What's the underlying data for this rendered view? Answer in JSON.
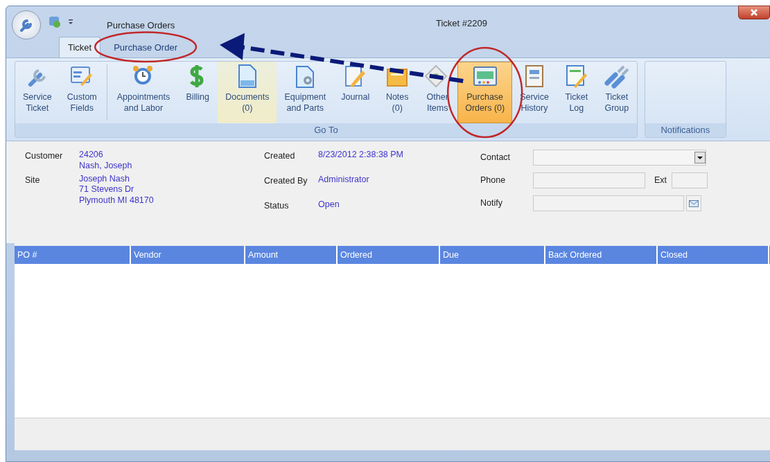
{
  "window": {
    "title": "Ticket #2209",
    "document_title": "Purchase Orders"
  },
  "ribbon_tabs": [
    {
      "label": "Ticket",
      "selected": true,
      "circled": false
    },
    {
      "label": "Purchase Order",
      "selected": false,
      "circled": true
    }
  ],
  "ribbon_groups": [
    {
      "label": "Go To",
      "clusters": [
        [
          {
            "lines": [
              "Service",
              "Ticket"
            ],
            "selected": false,
            "hovered": false,
            "circled": false
          },
          {
            "lines": [
              "Custom",
              "Fields"
            ],
            "selected": false,
            "hovered": false,
            "circled": false
          }
        ],
        [
          {
            "lines": [
              "Appointments",
              "and Labor"
            ],
            "selected": false,
            "hovered": false,
            "circled": false
          },
          {
            "lines": [
              "Billing"
            ],
            "selected": false,
            "hovered": false,
            "circled": false
          },
          {
            "lines": [
              "Documents",
              "(0)"
            ],
            "selected": false,
            "hovered": true,
            "circled": false
          },
          {
            "lines": [
              "Equipment",
              "and Parts"
            ],
            "selected": false,
            "hovered": false,
            "circled": false
          },
          {
            "lines": [
              "Journal"
            ],
            "selected": false,
            "hovered": false,
            "circled": false
          },
          {
            "lines": [
              "Notes",
              "(0)"
            ],
            "selected": false,
            "hovered": false,
            "circled": false
          },
          {
            "lines": [
              "Other",
              "Items"
            ],
            "selected": false,
            "hovered": false,
            "circled": false
          },
          {
            "lines": [
              "Purchase",
              "Orders (0)"
            ],
            "selected": true,
            "hovered": false,
            "circled": true
          },
          {
            "lines": [
              "Service",
              "History"
            ],
            "selected": false,
            "hovered": false,
            "circled": false
          },
          {
            "lines": [
              "Ticket",
              "Log"
            ],
            "selected": false,
            "hovered": false,
            "circled": false
          },
          {
            "lines": [
              "Ticket",
              "Group"
            ],
            "selected": false,
            "hovered": false,
            "circled": false
          }
        ]
      ]
    },
    {
      "label": "Notifications"
    }
  ],
  "annotation_arrow": true,
  "info_left": [
    {
      "label": "Customer",
      "lines": [
        "24206",
        "Nash, Joseph"
      ]
    },
    {
      "label": "Site",
      "lines": [
        "Joseph Nash",
        "71  Stevens Dr",
        "Plymouth MI 48170"
      ]
    }
  ],
  "info_middle": [
    {
      "label": "Created",
      "value": "8/23/2012 2:38:38 PM"
    },
    {
      "label": "Created By",
      "value": "Administrator"
    },
    {
      "label": "Status",
      "value": "Open"
    }
  ],
  "info_right": [
    {
      "label": "Contact",
      "kind": "dropdown"
    },
    {
      "label": "Phone",
      "kind": "phone",
      "ext_label": "Ext"
    },
    {
      "label": "Notify",
      "kind": "email"
    }
  ],
  "table": {
    "columns": [
      "PO #",
      "Vendor",
      "Amount",
      "Ordered",
      "Due",
      "Back Ordered",
      "Closed"
    ]
  }
}
